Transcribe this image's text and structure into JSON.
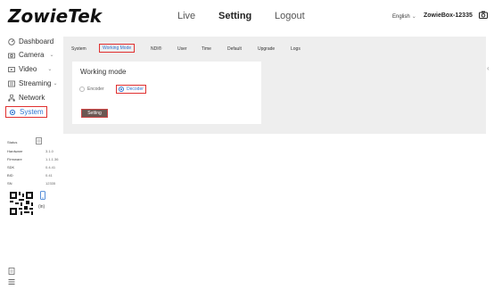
{
  "header": {
    "logo": "ZowieTek",
    "nav": [
      "Live",
      "Setting",
      "Logout"
    ],
    "language": "English",
    "device_name": "ZowieBox-12335"
  },
  "sidebar": {
    "items": [
      {
        "label": "Dashboard",
        "icon": "dashboard-icon"
      },
      {
        "label": "Camera",
        "icon": "camera-icon",
        "expandable": true
      },
      {
        "label": "Video",
        "icon": "video-icon",
        "expandable": true
      },
      {
        "label": "Streaming",
        "icon": "streaming-icon",
        "expandable": true
      },
      {
        "label": "Network",
        "icon": "network-icon"
      },
      {
        "label": "System",
        "icon": "system-icon",
        "active": true
      }
    ],
    "status": {
      "label": "Status",
      "rows": [
        {
          "key": "Hardware",
          "value": "3.1.0"
        },
        {
          "key": "Firmware",
          "value": "1.1.1.36"
        },
        {
          "key": "SDK",
          "value": "0.4.41"
        },
        {
          "key": "BID",
          "value": "0.41"
        },
        {
          "key": "SN",
          "value": "12335"
        }
      ]
    },
    "qr_label": "(in)"
  },
  "main": {
    "tabs": [
      "System",
      "Working Mode",
      "NDI®",
      "User",
      "Time",
      "Default",
      "Upgrade",
      "Logs"
    ],
    "active_tab": "Working Mode",
    "card": {
      "title": "Working mode",
      "options": [
        "Encoder",
        "Decoder"
      ],
      "selected": "Decoder",
      "save_label": "Setting"
    }
  },
  "colors": {
    "accent": "#2e74d0",
    "highlight": "#e03030",
    "button": "#6b5752"
  }
}
